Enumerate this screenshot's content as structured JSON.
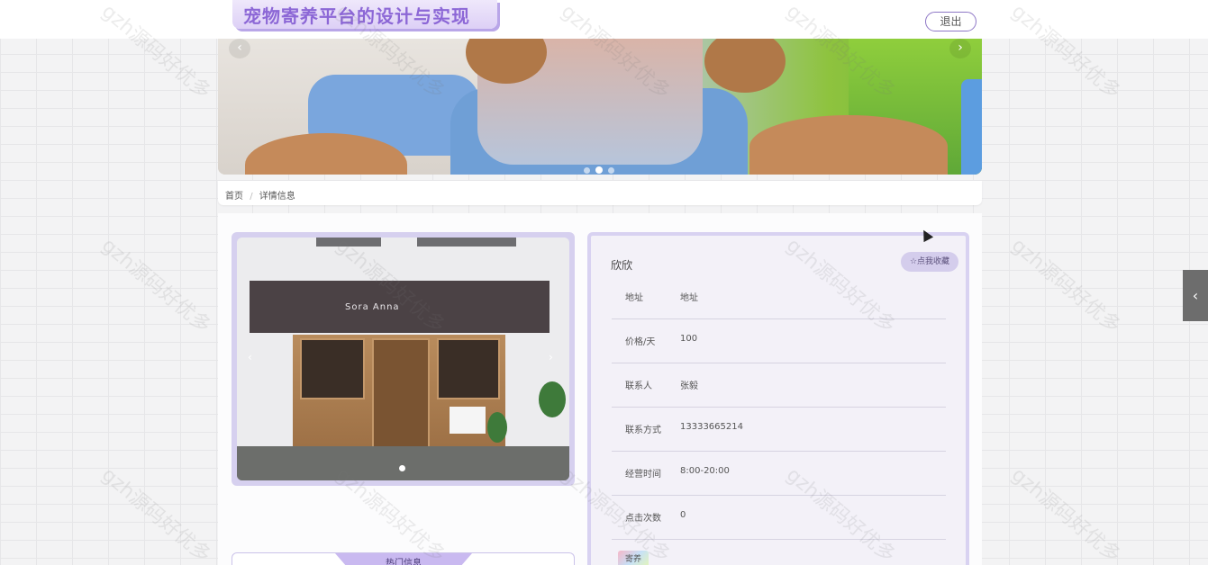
{
  "header": {
    "site_title": "宠物寄养平台的设计与实现",
    "logout_label": "退出"
  },
  "banner": {
    "prev_icon": "‹",
    "next_icon": "›",
    "slide_count": 3,
    "active_slide": 2
  },
  "breadcrumb": {
    "home": "首页",
    "separator": "/",
    "current": "详情信息"
  },
  "gallery": {
    "prev_icon": "‹",
    "next_icon": "›",
    "awning_text": "Sora Anna"
  },
  "details": {
    "name": "欣欣",
    "favorite_label": "☆点我收藏",
    "rows": [
      {
        "label": "地址",
        "value": "地址"
      },
      {
        "label": "价格/天",
        "value": "100"
      },
      {
        "label": "联系人",
        "value": "张毅"
      },
      {
        "label": "联系方式",
        "value": "13333665214"
      },
      {
        "label": "经营时间",
        "value": "8:00-20:00"
      },
      {
        "label": "点击次数",
        "value": "0"
      }
    ],
    "book_label": "寄养"
  },
  "hot_section": {
    "title": "热门信息"
  },
  "side_toggle_icon": "‹",
  "watermark_text": "gzh源码好优多",
  "icons": {
    "banner_prev": "chevron-left-icon",
    "banner_next": "chevron-right-icon",
    "gallery_prev": "chevron-left-icon",
    "gallery_next": "chevron-right-icon",
    "side_toggle": "chevron-left-icon"
  }
}
